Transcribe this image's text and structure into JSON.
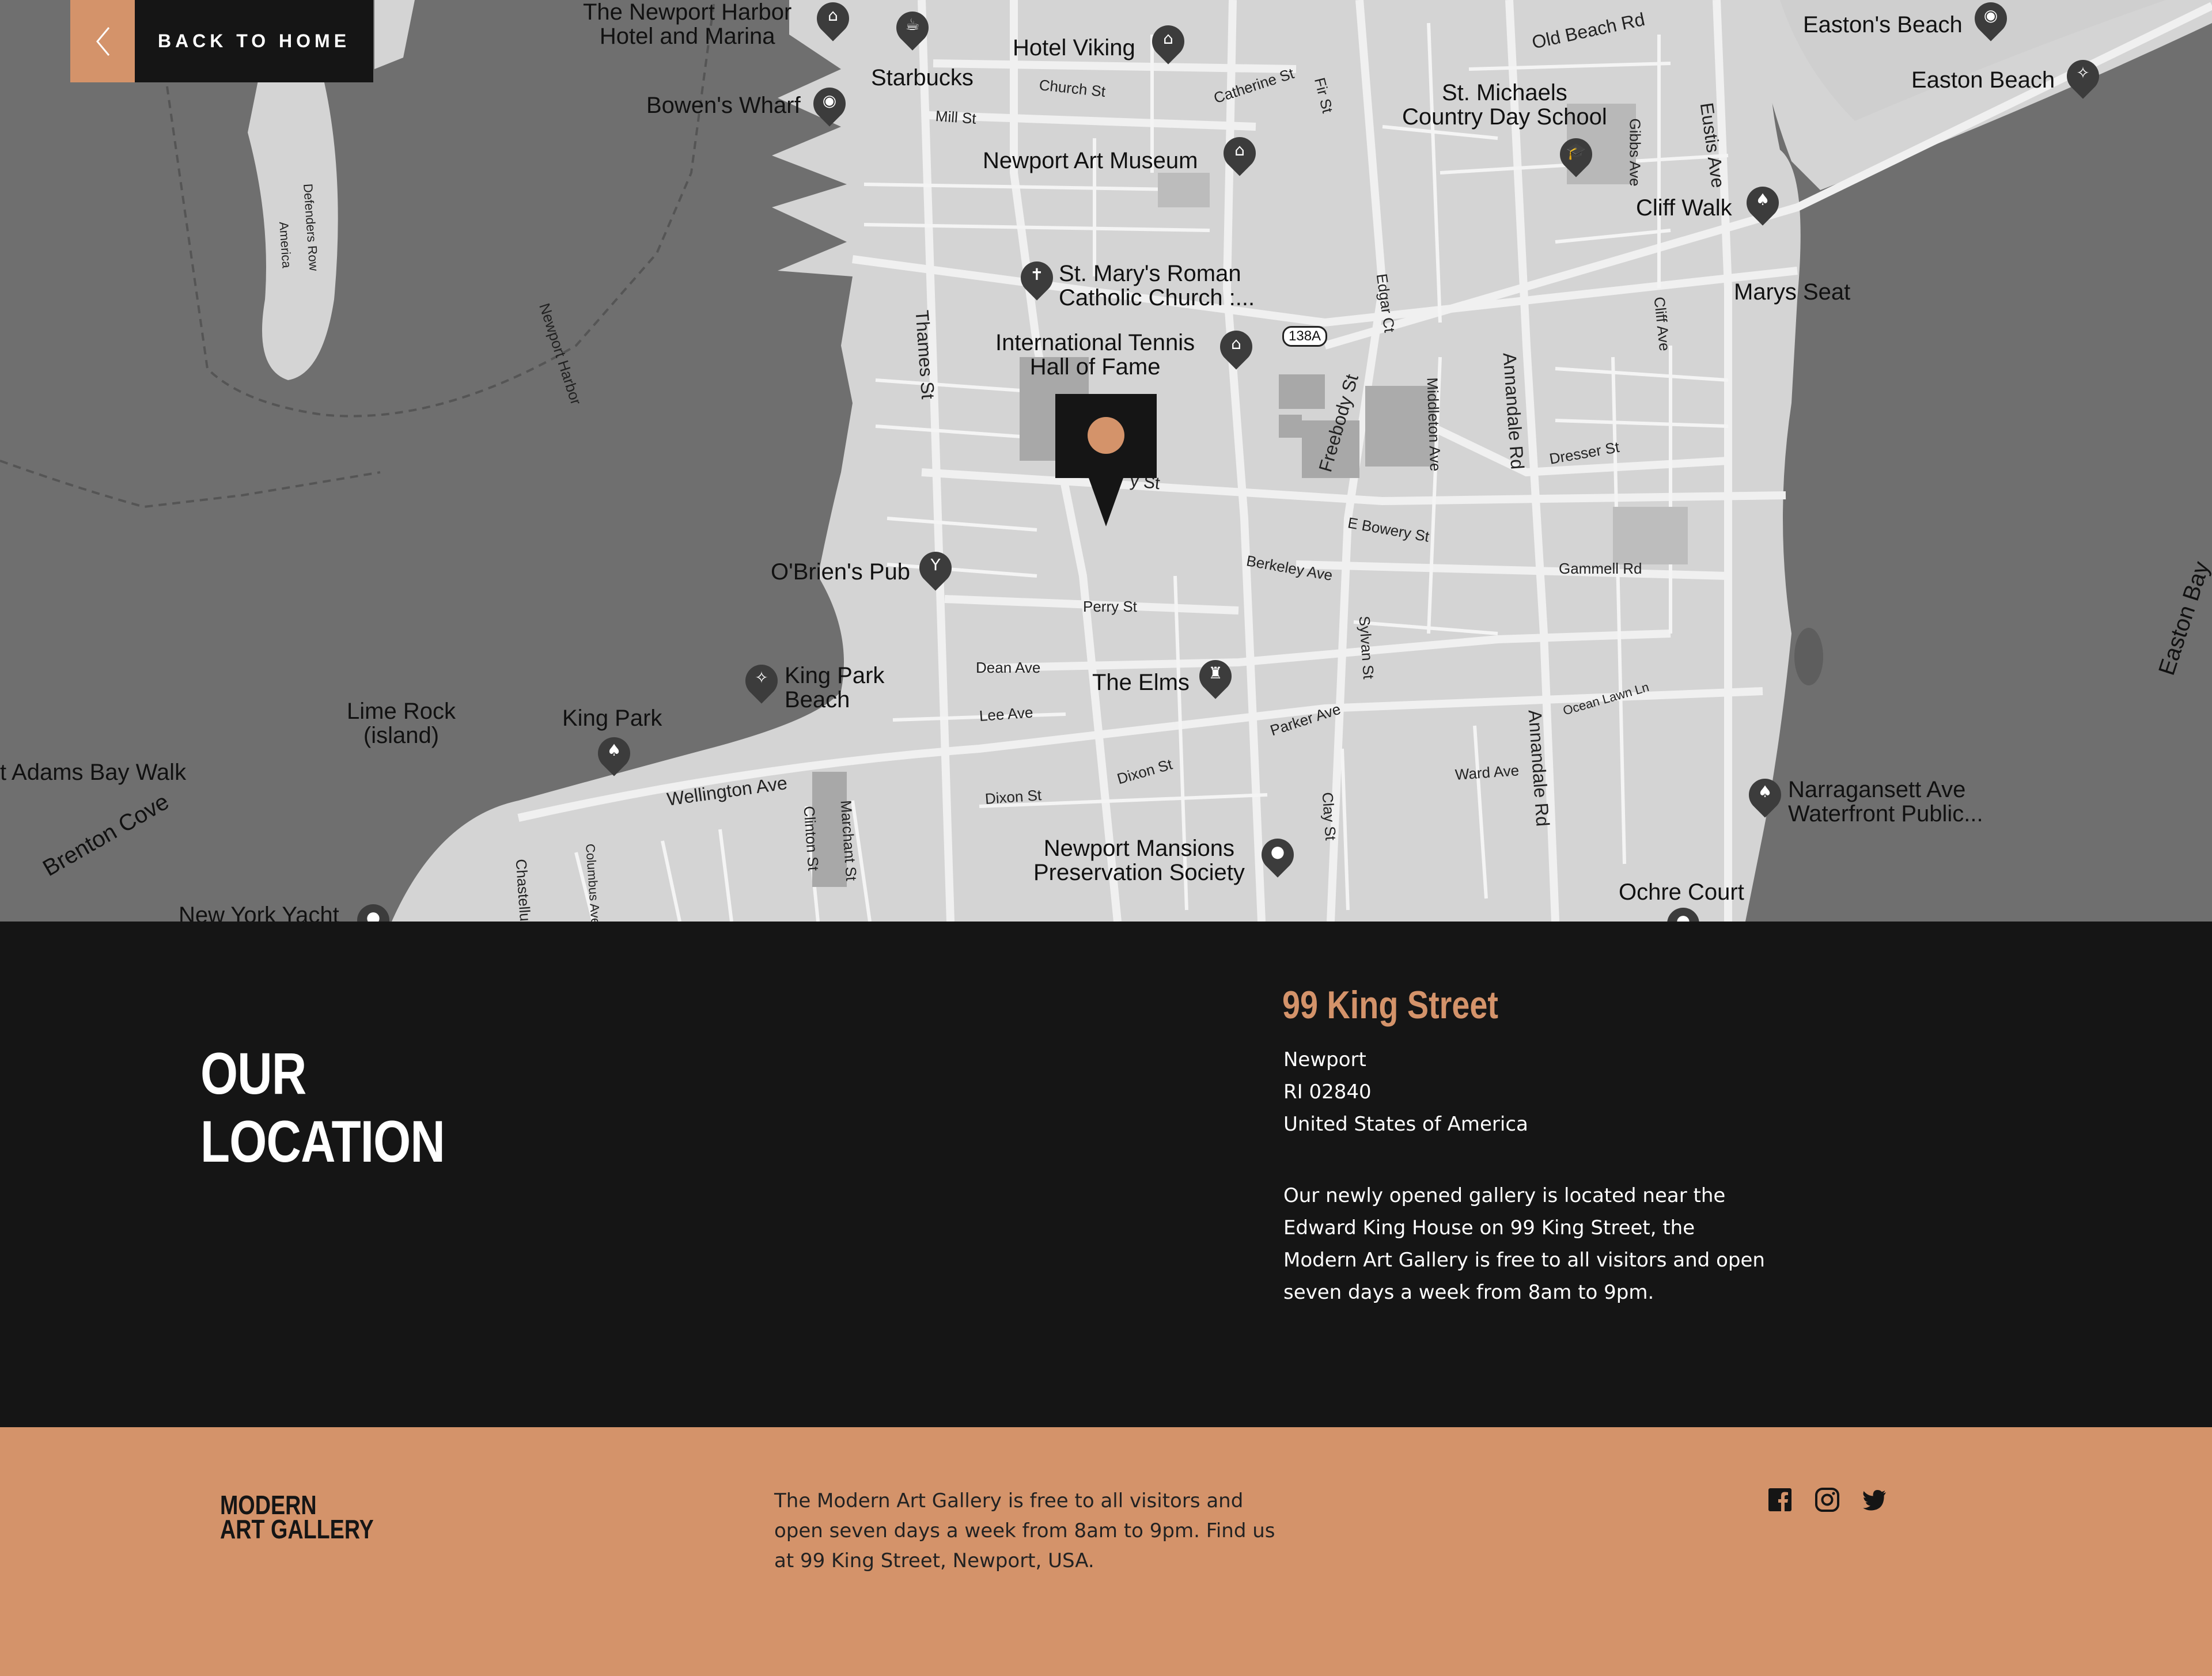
{
  "nav": {
    "back_label": "BACK TO HOME"
  },
  "map": {
    "places": {
      "newport_harbor_hotel": [
        "The Newport Harbor",
        "Hotel and Marina"
      ],
      "starbucks": "Starbucks",
      "hotel_viking": "Hotel Viking",
      "bowens_wharf": "Bowen's Wharf",
      "art_museum": "Newport Art Museum",
      "st_marys": [
        "St. Mary's Roman",
        "Catholic Church :..."
      ],
      "tennis_hof": [
        "International Tennis",
        "Hall of Fame"
      ],
      "st_michaels": [
        "St. Michaels",
        "Country Day School"
      ],
      "eastons_beach": "Easton's Beach",
      "easton_beach": "Easton Beach",
      "cliff_walk": "Cliff Walk",
      "marys_seat": "Marys Seat",
      "obriens_pub": "O'Brien's Pub",
      "king_park_beach": [
        "King Park",
        "Beach"
      ],
      "lime_rock": [
        "Lime Rock",
        "(island)"
      ],
      "king_park": "King Park",
      "adams_bay_walk": "t Adams Bay Walk",
      "the_elms": "The Elms",
      "mansions": [
        "Newport Mansions",
        "Preservation Society"
      ],
      "narragansett": [
        "Narragansett Ave",
        "Waterfront Public..."
      ],
      "ochre_court": "Ochre Court",
      "nyyc": "New York Yacht",
      "brenton_cove": "Brenton Cove",
      "easton_bay": "Easton Bay"
    },
    "streets": {
      "old_beach": "Old Beach Rd",
      "church": "Church St",
      "mill": "Mill St",
      "catherine": "Catherine St",
      "fir": "Fir St",
      "thames": "Thames St",
      "edgar": "Edgar Ct",
      "gibbs": "Gibbs Ave",
      "eustis": "Eustis Ave",
      "cliff_ave": "Cliff Ave",
      "freebody": "Freebody St",
      "middleton": "Middleton Ave",
      "annandale": "Annandale Rd",
      "dresser": "Dresser St",
      "bowery": "E Bowery St",
      "berkeley": "Berkeley Ave",
      "gammell": "Gammell Rd",
      "perry": "Perry St",
      "sylvan": "Sylvan St",
      "dean": "Dean Ave",
      "lee": "Lee Ave",
      "parker": "Parker Ave",
      "ocean_lawn": "Ocean Lawn Ln",
      "wellington": "Wellington Ave",
      "dixon": "Dixon St",
      "ward": "Ward Ave",
      "clay": "Clay St",
      "clinton": "Clinton St",
      "marchant": "Marchant St",
      "chastellux": "Chastellux",
      "columbus": "Columbus Ave",
      "newport_harbor": "Newport Harbor",
      "defenders": "Defenders Row",
      "america": "America",
      "route": "138A",
      "king_st_tail": "y St"
    }
  },
  "location": {
    "title_lines": [
      "OUR",
      "LOCATION"
    ],
    "address_heading": "99 King Street",
    "address_lines": [
      "Newport",
      "RI 02840",
      "United States of America"
    ],
    "description": "Our newly opened gallery is located near the Edward King House on 99 King Street, the Modern Art Gallery is free to all visitors and open seven days a week from 8am to 9pm."
  },
  "footer": {
    "logo_lines": [
      "MODERN",
      "ART GALLERY"
    ],
    "text": "The Modern Art Gallery is free to all visitors and open seven days a week from 8am to 9pm. Find us at 99 King Street, Newport, USA.",
    "social": [
      "facebook-icon",
      "instagram-icon",
      "twitter-icon"
    ]
  },
  "colors": {
    "accent": "#d4936a",
    "dark": "#151515",
    "water": "#6f6f6f",
    "land": "#d6d6d6"
  }
}
